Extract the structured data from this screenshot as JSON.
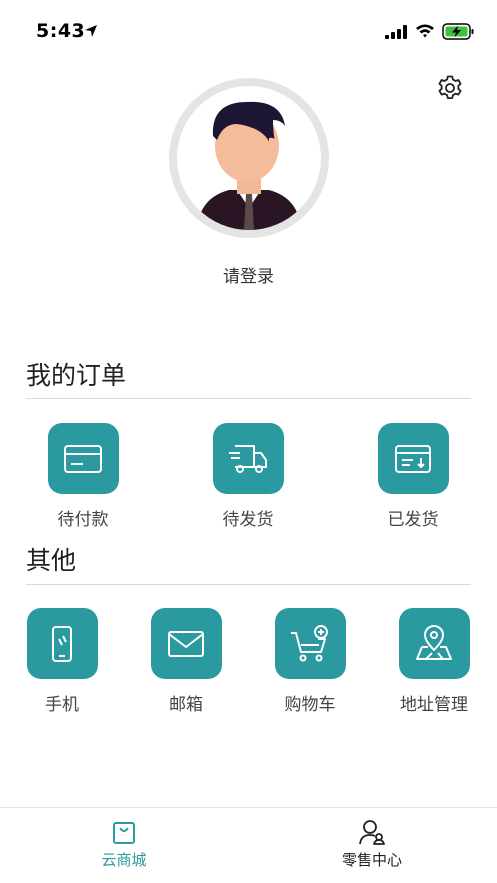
{
  "status_bar": {
    "time": "5:43"
  },
  "profile": {
    "login_label": "请登录"
  },
  "orders": {
    "title": "我的订单",
    "items": [
      {
        "label": "待付款",
        "icon": "card-icon"
      },
      {
        "label": "待发货",
        "icon": "truck-icon"
      },
      {
        "label": "已发货",
        "icon": "shipped-icon"
      }
    ]
  },
  "others": {
    "title": "其他",
    "items": [
      {
        "label": "手机",
        "icon": "phone-icon"
      },
      {
        "label": "邮箱",
        "icon": "mail-icon"
      },
      {
        "label": "购物车",
        "icon": "cart-icon"
      },
      {
        "label": "地址管理",
        "icon": "map-pin-icon"
      }
    ]
  },
  "tabbar": {
    "tabs": [
      {
        "label": "云商城",
        "icon": "shopping-bag-icon",
        "active": true
      },
      {
        "label": "零售中心",
        "icon": "user-icon",
        "active": false
      }
    ]
  },
  "colors": {
    "accent": "#2a9aa0",
    "battery": "#3ec13b"
  }
}
